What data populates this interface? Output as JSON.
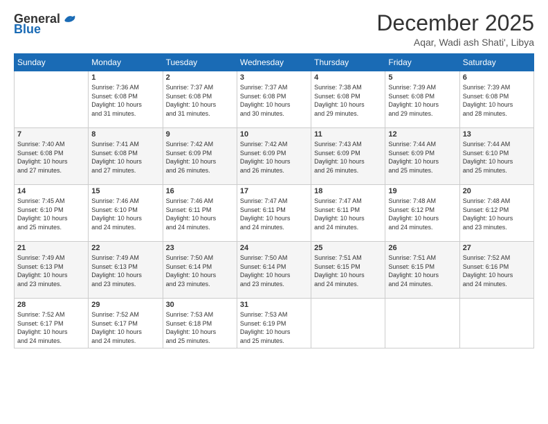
{
  "logo": {
    "text_general": "General",
    "text_blue": "Blue"
  },
  "header": {
    "month": "December 2025",
    "location": "Aqar, Wadi ash Shati', Libya"
  },
  "weekdays": [
    "Sunday",
    "Monday",
    "Tuesday",
    "Wednesday",
    "Thursday",
    "Friday",
    "Saturday"
  ],
  "weeks": [
    [
      {
        "day": "",
        "info": ""
      },
      {
        "day": "1",
        "info": "Sunrise: 7:36 AM\nSunset: 6:08 PM\nDaylight: 10 hours\nand 31 minutes."
      },
      {
        "day": "2",
        "info": "Sunrise: 7:37 AM\nSunset: 6:08 PM\nDaylight: 10 hours\nand 31 minutes."
      },
      {
        "day": "3",
        "info": "Sunrise: 7:37 AM\nSunset: 6:08 PM\nDaylight: 10 hours\nand 30 minutes."
      },
      {
        "day": "4",
        "info": "Sunrise: 7:38 AM\nSunset: 6:08 PM\nDaylight: 10 hours\nand 29 minutes."
      },
      {
        "day": "5",
        "info": "Sunrise: 7:39 AM\nSunset: 6:08 PM\nDaylight: 10 hours\nand 29 minutes."
      },
      {
        "day": "6",
        "info": "Sunrise: 7:39 AM\nSunset: 6:08 PM\nDaylight: 10 hours\nand 28 minutes."
      }
    ],
    [
      {
        "day": "7",
        "info": "Sunrise: 7:40 AM\nSunset: 6:08 PM\nDaylight: 10 hours\nand 27 minutes."
      },
      {
        "day": "8",
        "info": "Sunrise: 7:41 AM\nSunset: 6:08 PM\nDaylight: 10 hours\nand 27 minutes."
      },
      {
        "day": "9",
        "info": "Sunrise: 7:42 AM\nSunset: 6:09 PM\nDaylight: 10 hours\nand 26 minutes."
      },
      {
        "day": "10",
        "info": "Sunrise: 7:42 AM\nSunset: 6:09 PM\nDaylight: 10 hours\nand 26 minutes."
      },
      {
        "day": "11",
        "info": "Sunrise: 7:43 AM\nSunset: 6:09 PM\nDaylight: 10 hours\nand 26 minutes."
      },
      {
        "day": "12",
        "info": "Sunrise: 7:44 AM\nSunset: 6:09 PM\nDaylight: 10 hours\nand 25 minutes."
      },
      {
        "day": "13",
        "info": "Sunrise: 7:44 AM\nSunset: 6:10 PM\nDaylight: 10 hours\nand 25 minutes."
      }
    ],
    [
      {
        "day": "14",
        "info": "Sunrise: 7:45 AM\nSunset: 6:10 PM\nDaylight: 10 hours\nand 25 minutes."
      },
      {
        "day": "15",
        "info": "Sunrise: 7:46 AM\nSunset: 6:10 PM\nDaylight: 10 hours\nand 24 minutes."
      },
      {
        "day": "16",
        "info": "Sunrise: 7:46 AM\nSunset: 6:11 PM\nDaylight: 10 hours\nand 24 minutes."
      },
      {
        "day": "17",
        "info": "Sunrise: 7:47 AM\nSunset: 6:11 PM\nDaylight: 10 hours\nand 24 minutes."
      },
      {
        "day": "18",
        "info": "Sunrise: 7:47 AM\nSunset: 6:11 PM\nDaylight: 10 hours\nand 24 minutes."
      },
      {
        "day": "19",
        "info": "Sunrise: 7:48 AM\nSunset: 6:12 PM\nDaylight: 10 hours\nand 24 minutes."
      },
      {
        "day": "20",
        "info": "Sunrise: 7:48 AM\nSunset: 6:12 PM\nDaylight: 10 hours\nand 23 minutes."
      }
    ],
    [
      {
        "day": "21",
        "info": "Sunrise: 7:49 AM\nSunset: 6:13 PM\nDaylight: 10 hours\nand 23 minutes."
      },
      {
        "day": "22",
        "info": "Sunrise: 7:49 AM\nSunset: 6:13 PM\nDaylight: 10 hours\nand 23 minutes."
      },
      {
        "day": "23",
        "info": "Sunrise: 7:50 AM\nSunset: 6:14 PM\nDaylight: 10 hours\nand 23 minutes."
      },
      {
        "day": "24",
        "info": "Sunrise: 7:50 AM\nSunset: 6:14 PM\nDaylight: 10 hours\nand 23 minutes."
      },
      {
        "day": "25",
        "info": "Sunrise: 7:51 AM\nSunset: 6:15 PM\nDaylight: 10 hours\nand 24 minutes."
      },
      {
        "day": "26",
        "info": "Sunrise: 7:51 AM\nSunset: 6:15 PM\nDaylight: 10 hours\nand 24 minutes."
      },
      {
        "day": "27",
        "info": "Sunrise: 7:52 AM\nSunset: 6:16 PM\nDaylight: 10 hours\nand 24 minutes."
      }
    ],
    [
      {
        "day": "28",
        "info": "Sunrise: 7:52 AM\nSunset: 6:17 PM\nDaylight: 10 hours\nand 24 minutes."
      },
      {
        "day": "29",
        "info": "Sunrise: 7:52 AM\nSunset: 6:17 PM\nDaylight: 10 hours\nand 24 minutes."
      },
      {
        "day": "30",
        "info": "Sunrise: 7:53 AM\nSunset: 6:18 PM\nDaylight: 10 hours\nand 25 minutes."
      },
      {
        "day": "31",
        "info": "Sunrise: 7:53 AM\nSunset: 6:19 PM\nDaylight: 10 hours\nand 25 minutes."
      },
      {
        "day": "",
        "info": ""
      },
      {
        "day": "",
        "info": ""
      },
      {
        "day": "",
        "info": ""
      }
    ]
  ]
}
